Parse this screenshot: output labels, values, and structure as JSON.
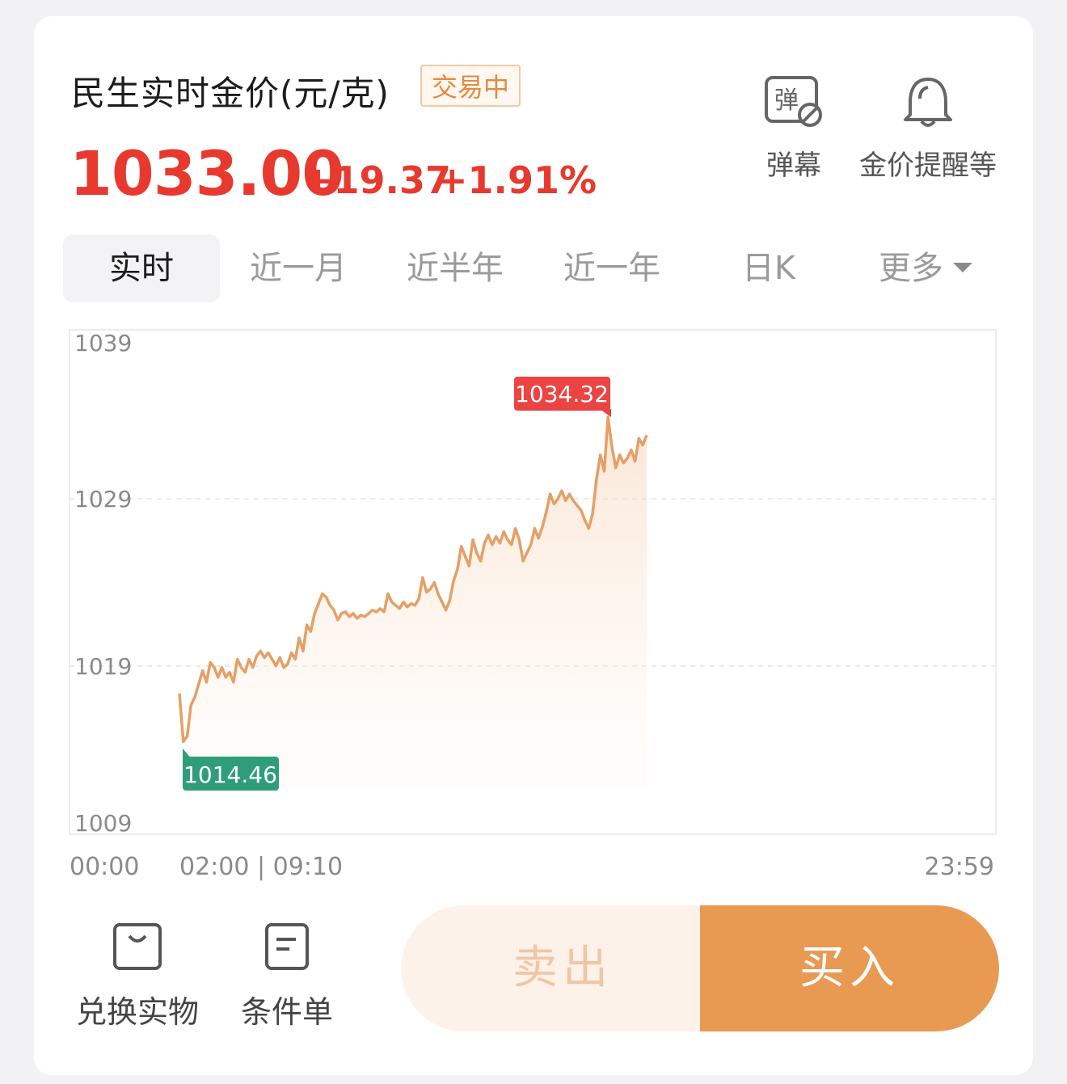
{
  "header": {
    "title": "民生实时金价(元/克)",
    "status_badge": "交易中",
    "price": "1033.00",
    "change_abs": "+19.37",
    "change_pct": "+1.91%"
  },
  "tools": {
    "danmu_icon_text": "弹",
    "danmu_label": "弹幕",
    "alert_label": "金价提醒等"
  },
  "tabs": [
    {
      "label": "实时",
      "active": true
    },
    {
      "label": "近一月",
      "active": false
    },
    {
      "label": "近半年",
      "active": false
    },
    {
      "label": "近一年",
      "active": false
    },
    {
      "label": "日K",
      "active": false
    },
    {
      "label": "更多",
      "active": false
    }
  ],
  "colors": {
    "price_up": "#e8392f",
    "line": "#e4a066",
    "high_tag": "#ec4343",
    "low_tag": "#2f9d7a",
    "buy": "#e89a52",
    "sell_bg": "#fdf2ea"
  },
  "chart_data": {
    "type": "area",
    "ylim": [
      1009,
      1039
    ],
    "y_ticks": [
      "1039",
      "1029",
      "1019",
      "1009"
    ],
    "x_tick_labels": [
      "00:00",
      "02:00 | 09:10",
      "23:59"
    ],
    "high_label": "1034.32",
    "low_label": "1014.46",
    "series": [
      {
        "values": [
          1017.4,
          1014.46,
          1014.8,
          1016.7,
          1017.2,
          1018.0,
          1018.8,
          1018.1,
          1019.3,
          1019.0,
          1018.4,
          1019.0,
          1018.4,
          1018.7,
          1018.1,
          1019.5,
          1019.0,
          1018.7,
          1019.5,
          1019.0,
          1019.7,
          1020.0,
          1019.6,
          1019.9,
          1019.5,
          1019.1,
          1019.6,
          1019.0,
          1019.2,
          1019.9,
          1019.5,
          1020.8,
          1020.0,
          1021.6,
          1021.2,
          1022.3,
          1022.9,
          1023.5,
          1023.3,
          1022.8,
          1022.5,
          1021.9,
          1022.3,
          1022.4,
          1022.1,
          1022.3,
          1022.0,
          1022.2,
          1022.1,
          1022.3,
          1022.5,
          1022.4,
          1022.6,
          1022.4,
          1023.5,
          1023.0,
          1022.8,
          1022.6,
          1023.0,
          1022.7,
          1022.9,
          1022.8,
          1023.2,
          1024.5,
          1023.6,
          1023.8,
          1024.2,
          1023.5,
          1023.0,
          1022.5,
          1023.1,
          1024.3,
          1025.0,
          1026.4,
          1025.8,
          1025.2,
          1026.8,
          1026.0,
          1025.5,
          1026.6,
          1027.1,
          1026.5,
          1027.0,
          1026.6,
          1027.3,
          1026.8,
          1026.5,
          1027.5,
          1026.8,
          1025.5,
          1026.0,
          1026.5,
          1027.5,
          1026.9,
          1027.6,
          1028.5,
          1029.6,
          1029.0,
          1029.3,
          1029.8,
          1029.2,
          1029.6,
          1029.2,
          1028.9,
          1028.6,
          1028.0,
          1027.5,
          1028.4,
          1030.5,
          1032.0,
          1031.0,
          1034.32,
          1032.5,
          1031.2,
          1032.0,
          1031.5,
          1031.8,
          1032.3,
          1031.6,
          1033.0,
          1032.6,
          1033.2
        ]
      }
    ]
  },
  "actions": {
    "redeem_label": "兑换实物",
    "conditional_label": "条件单",
    "sell_label": "卖出",
    "buy_label": "买入"
  }
}
